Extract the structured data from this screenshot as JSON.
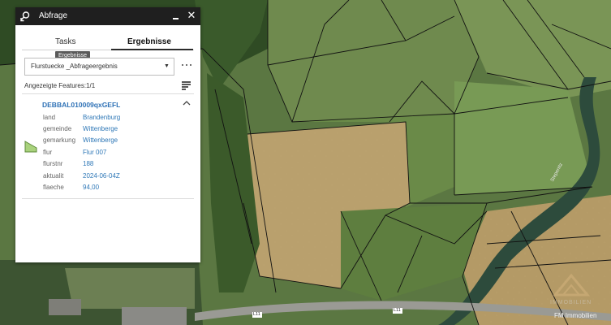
{
  "map": {
    "road_labels": [
      "L11",
      "L11"
    ],
    "stream_label": "Stepenitz",
    "watermark_text": "FM Immobilien",
    "watermark_logo_text": "IMMOBILIEN"
  },
  "panel": {
    "title": "Abfrage",
    "tabs": [
      {
        "label": "Tasks",
        "active": false
      },
      {
        "label": "Ergebnisse",
        "active": true
      }
    ],
    "tooltip": "Ergebnisse",
    "layer_select": {
      "value": "Flurstuecke _Abfrageergebnis"
    },
    "features_label": "Angezeigte Features:",
    "features_count": "1/1",
    "feature": {
      "id": "DEBBAL010009qxGEFL",
      "symbol_color": "#a9d27c",
      "attributes": [
        {
          "key": "land",
          "value": "Brandenburg"
        },
        {
          "key": "gemeinde",
          "value": "Wittenberge"
        },
        {
          "key": "gemarkung",
          "value": "Wittenberge"
        },
        {
          "key": "flur",
          "value": "Flur 007"
        },
        {
          "key": "flurstnr",
          "value": "188"
        },
        {
          "key": "aktualit",
          "value": "2024-06-04Z"
        },
        {
          "key": "flaeche",
          "value": "94,00"
        }
      ]
    }
  }
}
